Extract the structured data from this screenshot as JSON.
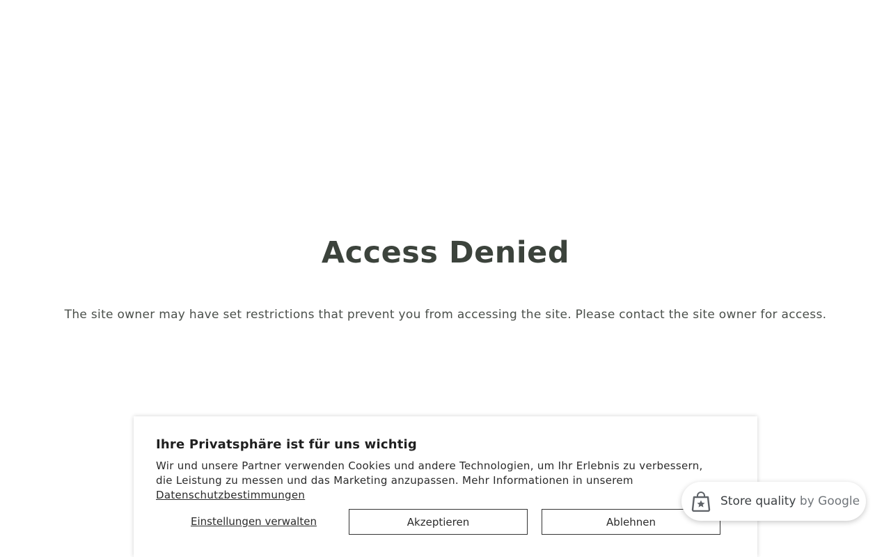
{
  "main": {
    "title": "Access Denied",
    "message": "The site owner may have set restrictions that prevent you from accessing the site. Please contact the site owner for access."
  },
  "cookie_banner": {
    "title": "Ihre Privatsphäre ist für uns wichtig",
    "text": "Wir und unsere Partner verwenden Cookies und andere Technologien, um Ihr Erlebnis zu verbessern, die Leistung zu messen und das Marketing anzupassen. Mehr Informationen in unserem ",
    "privacy_link": "Datenschutzbestimmungen",
    "manage_label": "Einstellungen verwalten",
    "accept_label": "Akzeptieren",
    "decline_label": "Ablehnen"
  },
  "store_badge": {
    "label": "Store quality",
    "by": "by Google",
    "icon": "shopping-bag-star-icon"
  }
}
